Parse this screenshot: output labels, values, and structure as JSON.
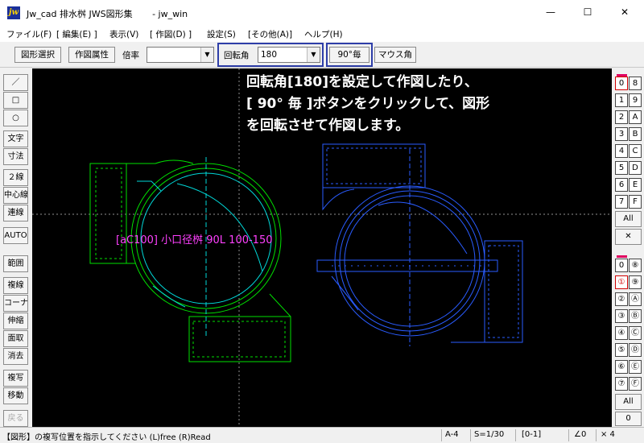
{
  "window": {
    "title": "Jw_cad 排水桝 JWS図形集       - jw_win",
    "minimize_glyph": "—",
    "maximize_glyph": "☐",
    "close_glyph": "✕"
  },
  "menu": [
    "ファイル(F)",
    "[ 編集(E) ]",
    "表示(V)",
    "[ 作図(D) ]",
    "設定(S)",
    "[その他(A)]",
    "ヘルプ(H)"
  ],
  "toolbar": {
    "select_label": "図形選択",
    "attr_label": "作図属性",
    "scale_label": "倍率",
    "scale_value": "",
    "rotate_label": "回転角",
    "rotate_value": "180",
    "deg90_label": "90°毎",
    "mouse_angle_label": "マウス角"
  },
  "left_tools": [
    "／",
    "□",
    "○",
    "文字",
    "寸法",
    "２線",
    "中心線",
    "連線",
    "AUTO",
    "範囲",
    "複線",
    "コーナー",
    "伸縮",
    "面取",
    "消去",
    "複写",
    "移動",
    "戻る"
  ],
  "layer_groups_top": [
    [
      "0",
      "8"
    ],
    [
      "1",
      "9"
    ],
    [
      "2",
      "A"
    ],
    [
      "3",
      "B"
    ],
    [
      "4",
      "C"
    ],
    [
      "5",
      "D"
    ],
    [
      "6",
      "E"
    ],
    [
      "7",
      "F"
    ]
  ],
  "layers_bottom": [
    [
      "0",
      "⑧"
    ],
    [
      "①",
      "⑨"
    ],
    [
      "②",
      "Ⓐ"
    ],
    [
      "③",
      "Ⓑ"
    ],
    [
      "④",
      "Ⓒ"
    ],
    [
      "⑤",
      "Ⓓ"
    ],
    [
      "⑥",
      "Ⓔ"
    ],
    [
      "⑦",
      "Ⓕ"
    ]
  ],
  "right_buttons": {
    "all_top": "All",
    "x_top": "✕",
    "all_bottom": "All",
    "zero_bottom": "0"
  },
  "canvas": {
    "annotation": [
      "回転角[180]を設定して作図したり、",
      "[ 90° 毎 ]ボタンをクリックして、図形",
      "を回転させて作図します。"
    ],
    "symbol_label": "[aC100]  小口径桝 90L 100-150"
  },
  "status": {
    "message": "【図形】の複写位置を指示してください (L)free (R)Read",
    "paper": "A-4",
    "scale": "S=1/30",
    "layer": "[0-1]",
    "angle": "∠0",
    "grid": "× 4"
  },
  "colors": {
    "canvas_bg": "#000000",
    "green_symbol": "#00e000",
    "cyan": "#00d8d8",
    "blue_symbol": "#2a5cff",
    "magenta_text": "#ff40ff",
    "highlight_border": "#2e3ea8"
  }
}
